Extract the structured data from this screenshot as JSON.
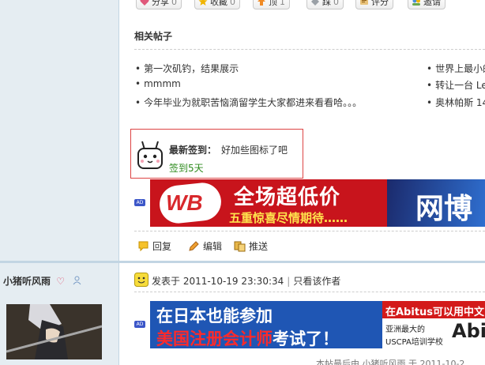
{
  "actions": {
    "share": {
      "label": "分享",
      "count": "0"
    },
    "favorite": {
      "label": "收藏",
      "count": "0"
    },
    "support": {
      "label": "顶",
      "count": "1"
    },
    "oppose": {
      "label": "踩",
      "count": "0"
    },
    "rate_label": "评分",
    "invite_label": "邀请"
  },
  "related": {
    "title": "相关帖子",
    "left": [
      "第一次矶钓，结果展示",
      "mmmm",
      "今年毕业为就职苦恼滴留学生大家都进来看看哈。。。"
    ],
    "right": [
      "世界上最小的",
      "转让一台 Le",
      "奥林帕斯 14"
    ]
  },
  "sign": {
    "label": "最新签到：",
    "text": "好加些图标了吧",
    "days": "签到5天"
  },
  "ad_badge": "AD",
  "banner1": {
    "logo": "WB",
    "headline": "全场超低价",
    "subline": "五重惊喜尽情期待……",
    "brand": "网博"
  },
  "post_actions": {
    "reply": "回复",
    "edit": "编辑",
    "push": "推送"
  },
  "author": {
    "name": "小猪听风雨"
  },
  "post": {
    "posted_at": "发表于 2011-10-19 23:30:34",
    "only_author": "只看该作者"
  },
  "banner2": {
    "line1": "在日本也能参加",
    "line2_red": "美国注册会计师",
    "line2_rest": "考试了！",
    "right_top": "在Abitus可以用中文",
    "right_mid": "亚洲最大的",
    "right_bottom": "USCPA培训学校",
    "right_logo": "Abi"
  },
  "bottom_text": "本帖最后由 小猪听风雨 于 2011-10-2"
}
